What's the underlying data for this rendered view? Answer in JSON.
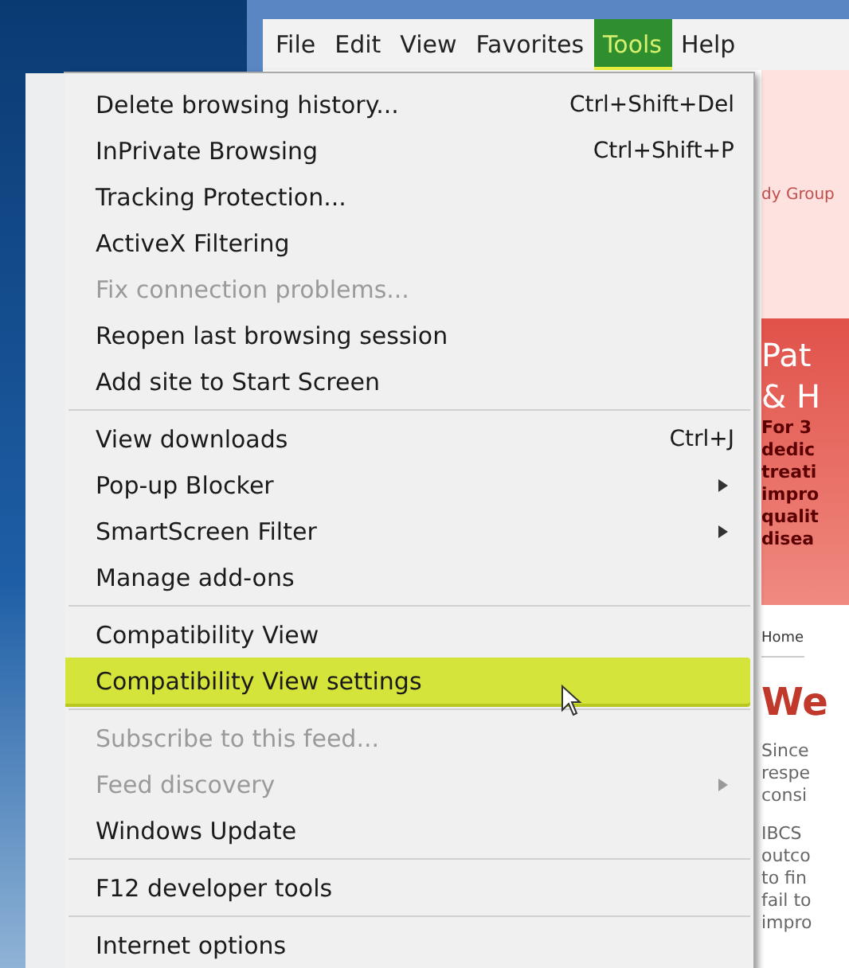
{
  "menu_bar": [
    {
      "label": "File",
      "selected": false
    },
    {
      "label": "Edit",
      "selected": false
    },
    {
      "label": "View",
      "selected": false
    },
    {
      "label": "Favorites",
      "selected": false
    },
    {
      "label": "Tools",
      "selected": true
    },
    {
      "label": "Help",
      "selected": false
    }
  ],
  "menu_groups": [
    {
      "items": [
        {
          "label": "Delete browsing history...",
          "shortcut": "Ctrl+Shift+Del",
          "submenu": false,
          "disabled": false,
          "selected": false
        },
        {
          "label": "InPrivate Browsing",
          "shortcut": "Ctrl+Shift+P",
          "submenu": false,
          "disabled": false,
          "selected": false
        },
        {
          "label": "Tracking Protection...",
          "submenu": false,
          "disabled": false,
          "selected": false
        },
        {
          "label": "ActiveX Filtering",
          "submenu": false,
          "disabled": false,
          "selected": false
        },
        {
          "label": "Fix connection problems...",
          "submenu": false,
          "disabled": true,
          "selected": false
        },
        {
          "label": "Reopen last browsing session",
          "submenu": false,
          "disabled": false,
          "selected": false
        },
        {
          "label": "Add site to Start Screen",
          "submenu": false,
          "disabled": false,
          "selected": false
        }
      ]
    },
    {
      "items": [
        {
          "label": "View downloads",
          "shortcut": "Ctrl+J",
          "submenu": false,
          "disabled": false,
          "selected": false
        },
        {
          "label": "Pop-up Blocker",
          "submenu": true,
          "disabled": false,
          "selected": false
        },
        {
          "label": "SmartScreen Filter",
          "submenu": true,
          "disabled": false,
          "selected": false
        },
        {
          "label": "Manage add-ons",
          "submenu": false,
          "disabled": false,
          "selected": false
        }
      ]
    },
    {
      "items": [
        {
          "label": "Compatibility View",
          "submenu": false,
          "disabled": false,
          "selected": false
        },
        {
          "label": "Compatibility View settings",
          "submenu": false,
          "disabled": false,
          "selected": true
        }
      ]
    },
    {
      "items": [
        {
          "label": "Subscribe to this feed...",
          "submenu": false,
          "disabled": true,
          "selected": false
        },
        {
          "label": "Feed discovery",
          "submenu": true,
          "disabled": true,
          "selected": false
        },
        {
          "label": "Windows Update",
          "submenu": false,
          "disabled": false,
          "selected": false
        }
      ]
    },
    {
      "items": [
        {
          "label": "F12 developer tools",
          "submenu": false,
          "disabled": false,
          "selected": false
        }
      ]
    },
    {
      "items": [
        {
          "label": "Internet options",
          "submenu": false,
          "disabled": false,
          "selected": false
        }
      ]
    }
  ],
  "page": {
    "header_text": "dy Group",
    "banner_title": [
      "Pat",
      "& H"
    ],
    "banner_body": [
      "For 3",
      "dedic",
      "treati",
      "impro",
      "qualit",
      "disea"
    ],
    "breadcrumb": "Home",
    "heading": "We",
    "paragraphs": [
      [
        "Since",
        "respe",
        "consi"
      ],
      [
        "IBCS",
        "outco",
        "to fin",
        "fail to",
        "impro"
      ]
    ]
  }
}
